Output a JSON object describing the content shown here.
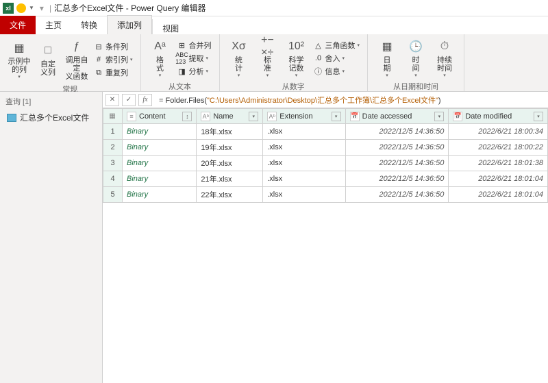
{
  "titlebar": {
    "app_icon": "xI",
    "title": "汇总多个Excel文件 - Power Query 编辑器"
  },
  "tabs": {
    "file": "文件",
    "home": "主页",
    "transform": "转换",
    "addcol": "添加列",
    "view": "视图"
  },
  "ribbon": {
    "group1": {
      "label": "常规",
      "btn1": "示例中\n的列",
      "btn2": "自定\n义列",
      "btn3": "调用自定\n义函数",
      "sm1": "条件列",
      "sm2": "索引列",
      "sm3": "重复列"
    },
    "group2": {
      "label": "从文本",
      "btn1": "格\n式",
      "btn2": "提取",
      "sm1": "合并列",
      "sm2": "分析"
    },
    "group3": {
      "label": "从数字",
      "btn1": "统\n计",
      "btn2": "标\n准",
      "btn3": "科学\n记数",
      "sm1": "三角函数",
      "sm2": "舍入",
      "sm3": "信息",
      "i1": "Xσ",
      "i2": "10²"
    },
    "group4": {
      "label": "从日期和时间",
      "btn1": "日\n期",
      "btn2": "时\n间",
      "btn3": "持续\n时间"
    }
  },
  "sidebar": {
    "header": "查询 [1]",
    "query": "汇总多个Excel文件"
  },
  "formula": {
    "fx": "fx",
    "text_plain": "= Folder.Files(\"C:\\Users\\Administrator\\Desktop\\汇总多个工作簿\\汇总多个Excel文件\")",
    "prefix": "= Folder.Files(",
    "str": "\"C:\\Users\\Administrator\\Desktop\\汇总多个工作簿\\汇总多个Excel文件\"",
    "suffix": ")"
  },
  "columns": {
    "content": "Content",
    "name": "Name",
    "ext": "Extension",
    "accessed": "Date accessed",
    "modified": "Date modified"
  },
  "chart_data": {
    "type": "table",
    "columns": [
      "Content",
      "Name",
      "Extension",
      "Date accessed",
      "Date modified"
    ],
    "rows": [
      {
        "n": 1,
        "content": "Binary",
        "name": "18年.xlsx",
        "ext": ".xlsx",
        "accessed": "2022/12/5 14:36:50",
        "modified": "2022/6/21 18:00:34"
      },
      {
        "n": 2,
        "content": "Binary",
        "name": "19年.xlsx",
        "ext": ".xlsx",
        "accessed": "2022/12/5 14:36:50",
        "modified": "2022/6/21 18:00:22"
      },
      {
        "n": 3,
        "content": "Binary",
        "name": "20年.xlsx",
        "ext": ".xlsx",
        "accessed": "2022/12/5 14:36:50",
        "modified": "2022/6/21 18:01:38"
      },
      {
        "n": 4,
        "content": "Binary",
        "name": "21年.xlsx",
        "ext": ".xlsx",
        "accessed": "2022/12/5 14:36:50",
        "modified": "2022/6/21 18:01:04"
      },
      {
        "n": 5,
        "content": "Binary",
        "name": "22年.xlsx",
        "ext": ".xlsx",
        "accessed": "2022/12/5 14:36:50",
        "modified": "2022/6/21 18:01:04"
      }
    ]
  }
}
